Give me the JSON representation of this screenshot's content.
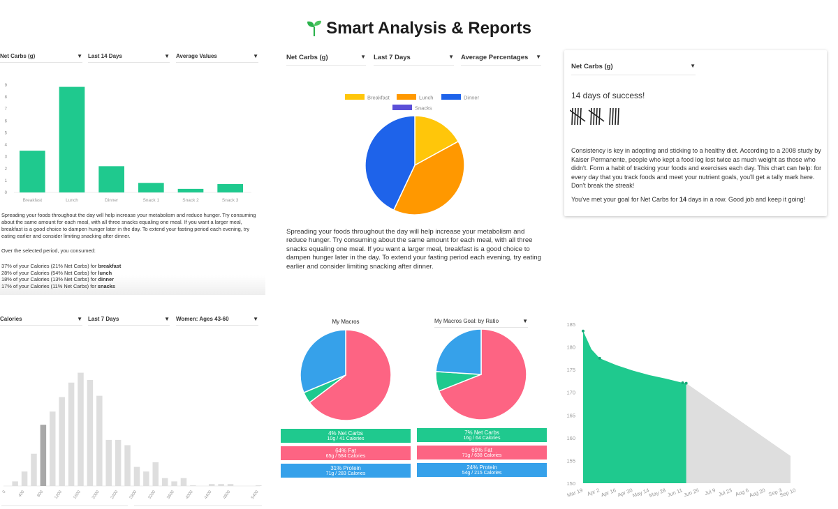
{
  "page_title": "Smart Analysis & Reports",
  "title_icon": "sprout-icon",
  "colors": {
    "green": "#1fc98e",
    "pink": "#fd6483",
    "blue": "#36a1ea",
    "yellow": "#ffc60a",
    "orange": "#ff9800",
    "dinner_blue": "#1e63ea",
    "snacks_purple": "#5b4fd8",
    "gray": "#dedede",
    "dark_gray": "#a8a8a8"
  },
  "meal_bars": {
    "dropdowns": [
      "Net Carbs (g)",
      "Last 14 Days",
      "Average Values"
    ],
    "chart_data": {
      "type": "bar",
      "categories": [
        "Breakfast",
        "Lunch",
        "Dinner",
        "Snack 1",
        "Snack 2",
        "Snack 3"
      ],
      "values": [
        3.5,
        8.85,
        2.2,
        0.8,
        0.3,
        0.7
      ],
      "yticks": [
        "0",
        "1",
        "2",
        "3",
        "4",
        "5",
        "6",
        "7",
        "8",
        "9"
      ],
      "ylim": [
        0,
        9
      ]
    },
    "paragraph": "Spreading your foods throughout the day will help increase your metabolism and reduce hunger. Try consuming about the same amount for each meal, with all three snacks equaling one meal. If you want a larger meal, breakfast is a good choice to dampen hunger later in the day. To extend your fasting period each evening, try eating earlier and consider limiting snacking after dinner.",
    "intro": "Over the selected period, you consumed:",
    "summary": [
      {
        "text": "37% of your Calories (21% Net Carbs) for ",
        "meal": "breakfast"
      },
      {
        "text": "28% of your Calories (54% Net Carbs) for ",
        "meal": "lunch"
      },
      {
        "text": "18% of your Calories (13% Net Carbs) for ",
        "meal": "dinner"
      },
      {
        "text": "17% of your Calories (11% Net Carbs) for ",
        "meal": "snacks"
      }
    ]
  },
  "meal_pie": {
    "dropdowns": [
      "Net Carbs (g)",
      "Last 7 Days",
      "Average Percentages"
    ],
    "chart_data": {
      "type": "pie",
      "legend": "top",
      "labels": [
        "Breakfast",
        "Lunch",
        "Dinner",
        "Snacks"
      ],
      "values": [
        17,
        40,
        43,
        0
      ]
    },
    "paragraph": "Spreading your foods throughout the day will help increase your metabolism and reduce hunger. Try consuming about the same amount for each meal, with all three snacks equaling one meal. If you want a larger meal, breakfast is a good choice to dampen hunger later in the day. To extend your fasting period each evening, try eating earlier and consider limiting snacking after dinner."
  },
  "streak": {
    "dropdown": "Net Carbs (g)",
    "headline": "14 days of success!",
    "tally_count": 14,
    "paragraph": "Consistency is key in adopting and sticking to a healthy diet. According to a 2008 study by Kaiser Permanente, people who kept a food log lost twice as much weight as those who didn't. Form a habit of tracking your foods and exercises each day. This chart can help: for every day that you track foods and meet your nutrient goals, you'll get a tally mark here. Don't break the streak!",
    "goal_pre": "You've met your goal for Net Carbs for ",
    "goal_days": "14",
    "goal_post": " days in a row. Good job and keep it going!"
  },
  "histogram": {
    "dropdowns": [
      "Calories",
      "Last 7 Days",
      "Women: Ages 43-60"
    ],
    "chart_data": {
      "type": "bar",
      "x": [
        200,
        400,
        600,
        800,
        1000,
        1200,
        1400,
        1600,
        1800,
        2000,
        2200,
        2400,
        2600,
        2800,
        3000,
        3200,
        3400,
        3600,
        3800,
        4000,
        4200,
        4400,
        4600,
        4800,
        5000,
        5200,
        5400
      ],
      "values": [
        7,
        22,
        49,
        93,
        113,
        135,
        157,
        172,
        161,
        137,
        70,
        70,
        62,
        29,
        22,
        36,
        12,
        7,
        12,
        1,
        0,
        3,
        3,
        3,
        0,
        0,
        1
      ],
      "highlighted_x": 800,
      "xticks": [
        "0",
        "400",
        "800",
        "1200",
        "1600",
        "2000",
        "2400",
        "2800",
        "3200",
        "3600",
        "4000",
        "4400",
        "4800",
        "5400"
      ]
    }
  },
  "macros": {
    "left_title": "My Macros",
    "right_dropdown": "My Macros Goal: by Ratio",
    "chart_data": [
      {
        "type": "pie",
        "labels": [
          "Fat",
          "Net Carbs",
          "Protein"
        ],
        "values": [
          64,
          4,
          31
        ]
      },
      {
        "type": "pie",
        "labels": [
          "Fat",
          "Net Carbs",
          "Protein"
        ],
        "values": [
          69,
          7,
          24
        ]
      }
    ],
    "left_boxes": [
      {
        "title": "4% Net Carbs",
        "detail": "10g / 41 Calories"
      },
      {
        "title": "64% Fat",
        "detail": "65g / 584 Calories"
      },
      {
        "title": "31% Protein",
        "detail": "71g / 283 Calories"
      }
    ],
    "right_boxes": [
      {
        "title": "7% Net Carbs",
        "detail": "16g / 64 Calories"
      },
      {
        "title": "69% Fat",
        "detail": "71g / 638 Calories"
      },
      {
        "title": "24% Protein",
        "detail": "54g / 215 Calories"
      }
    ]
  },
  "weight": {
    "chart_data": {
      "type": "area",
      "ylim": [
        150,
        185
      ],
      "yticks": [
        "150",
        "155",
        "160",
        "165",
        "170",
        "175",
        "180",
        "185"
      ],
      "xticks": [
        "Mar 19",
        "Apr 2",
        "Apr 16",
        "Apr 30",
        "May 14",
        "May 28",
        "Jun 11",
        "Jun 25",
        "Jul 9",
        "Jul 23",
        "Aug 6",
        "Aug 20",
        "Sep 3",
        "Sep 10"
      ],
      "actual": [
        [
          "Mar 19",
          183.5
        ],
        [
          "Mar 26",
          179.5
        ],
        [
          "Apr 2",
          177.5
        ],
        [
          "Apr 16",
          176
        ],
        [
          "Apr 30",
          174.8
        ],
        [
          "May 14",
          173.8
        ],
        [
          "May 28",
          173
        ],
        [
          "Jun 11",
          172.1
        ],
        [
          "Jun 14",
          172
        ]
      ],
      "projection": [
        [
          "Jun 14",
          172
        ],
        [
          "Sep 10",
          156
        ]
      ]
    }
  }
}
